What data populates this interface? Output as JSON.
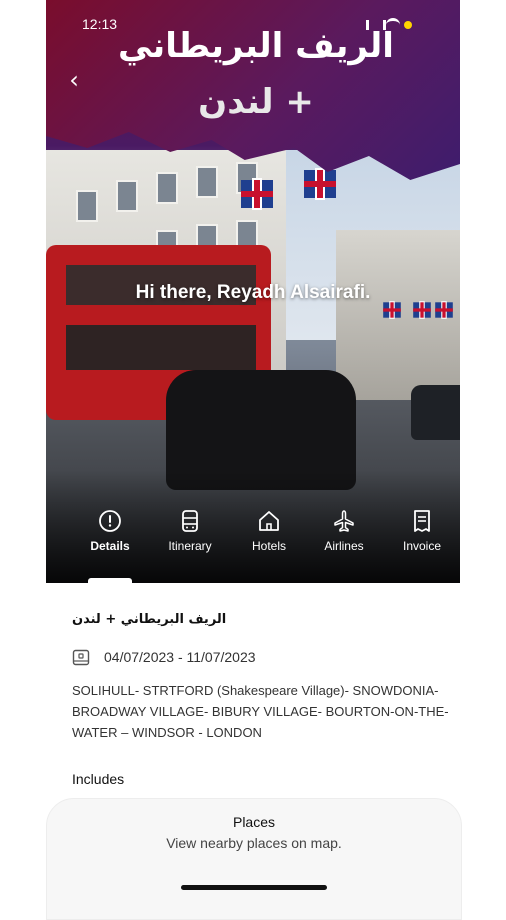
{
  "status_bar": {
    "time": "12:13"
  },
  "hero": {
    "title_line1": "الريف البريطاني",
    "title_line2": "+ لندن",
    "greeting": "Hi there, Reyadh Alsairafi."
  },
  "tabs": [
    {
      "label": "Details",
      "icon": "info-icon",
      "active": true
    },
    {
      "label": "Itinerary",
      "icon": "itinerary-icon",
      "active": false
    },
    {
      "label": "Hotels",
      "icon": "home-icon",
      "active": false
    },
    {
      "label": "Airlines",
      "icon": "airplane-icon",
      "active": false
    },
    {
      "label": "Invoice",
      "icon": "invoice-icon",
      "active": false
    }
  ],
  "details": {
    "trip_name": "الريف البريطاني + لندن",
    "dates": "04/07/2023 - 11/07/2023",
    "route": "SOLIHULL- STRTFORD (Shakespeare Village)- SNOWDONIA- BROADWAY VILLAGE- BIBURY VILLAGE- BOURTON-ON-THE-WATER – WINDSOR - LONDON",
    "includes_label": "Includes"
  },
  "places_card": {
    "title": "Places",
    "subtitle": "View nearby places on map."
  },
  "colors": {
    "accent": "#6a0f3d",
    "text": "#111111",
    "tab_text": "#ffffff"
  }
}
